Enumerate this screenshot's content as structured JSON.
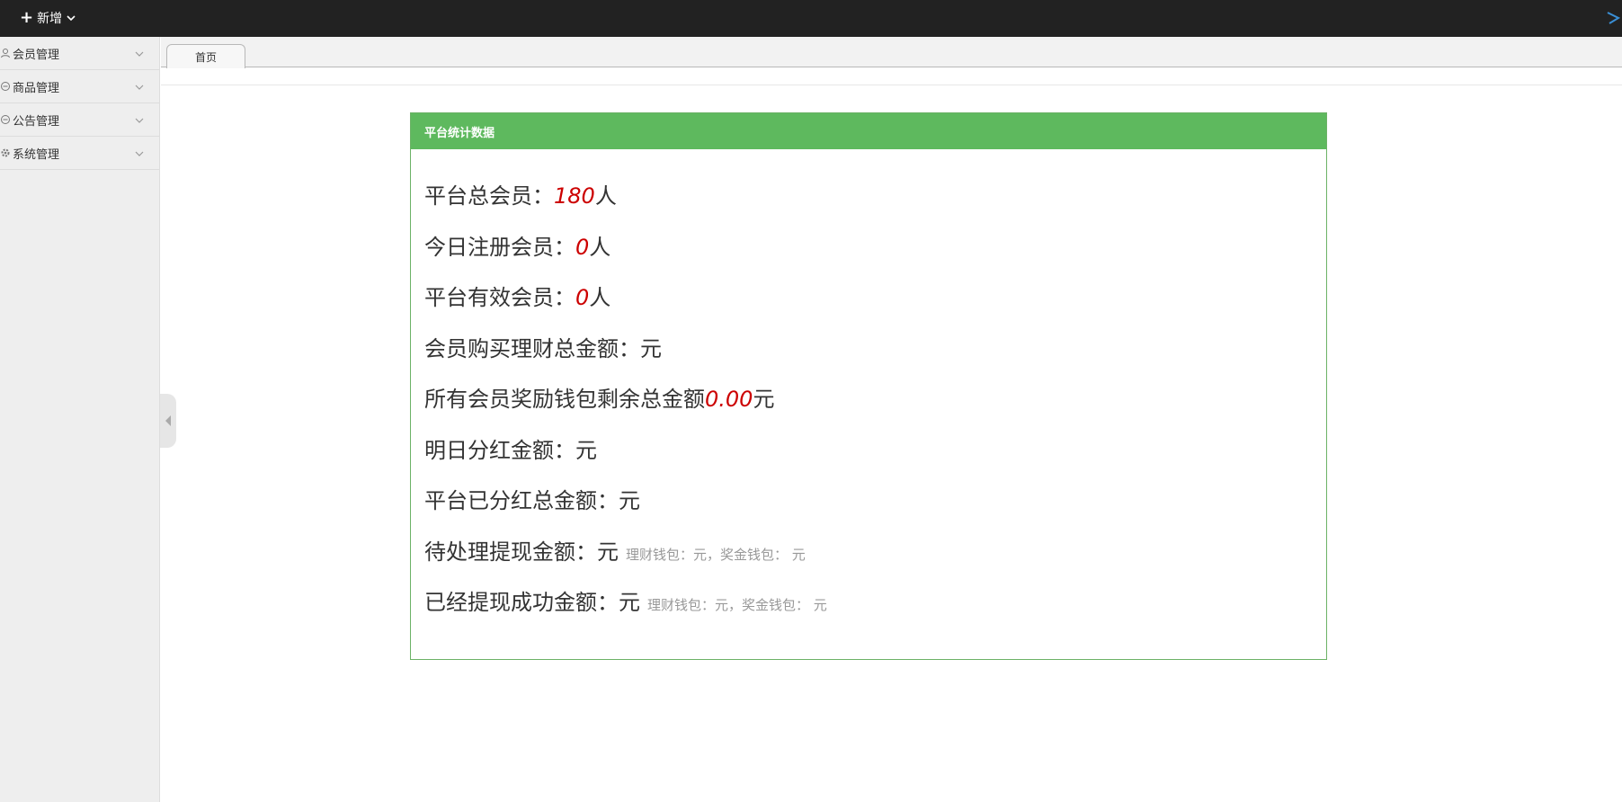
{
  "topbar": {
    "add_label": "新增"
  },
  "sidebar": {
    "items": [
      {
        "label": "会员管理",
        "icon": "user-icon"
      },
      {
        "label": "商品管理",
        "icon": "goods-icon"
      },
      {
        "label": "公告管理",
        "icon": "notice-icon"
      },
      {
        "label": "系统管理",
        "icon": "gear-icon"
      }
    ]
  },
  "tabs": [
    {
      "label": "首页"
    }
  ],
  "panel": {
    "title": "平台统计数据",
    "rows": [
      {
        "label": "平台总会员：",
        "value": "180",
        "unit": "人",
        "detail": ""
      },
      {
        "label": "今日注册会员：",
        "value": "0",
        "unit": "人",
        "detail": ""
      },
      {
        "label": "平台有效会员：",
        "value": "0",
        "unit": "人",
        "detail": ""
      },
      {
        "label": "会员购买理财总金额：",
        "value": "",
        "unit": "元",
        "detail": ""
      },
      {
        "label": "所有会员奖励钱包剩余总金额",
        "value": "0.00",
        "unit": "元",
        "detail": ""
      },
      {
        "label": "明日分红金额：",
        "value": "",
        "unit": "元",
        "detail": ""
      },
      {
        "label": "平台已分红总金额：",
        "value": "",
        "unit": "元",
        "detail": ""
      },
      {
        "label": "待处理提现金额：",
        "value": "",
        "unit": "元",
        "detail": "理财钱包：元，奖金钱包： 元"
      },
      {
        "label": "已经提现成功金额：",
        "value": "",
        "unit": "元",
        "detail": "理财钱包：元，奖金钱包： 元"
      }
    ]
  },
  "colors": {
    "topbar_bg": "#222222",
    "panel_header": "#5eb95e",
    "value_red": "#cc0000"
  }
}
